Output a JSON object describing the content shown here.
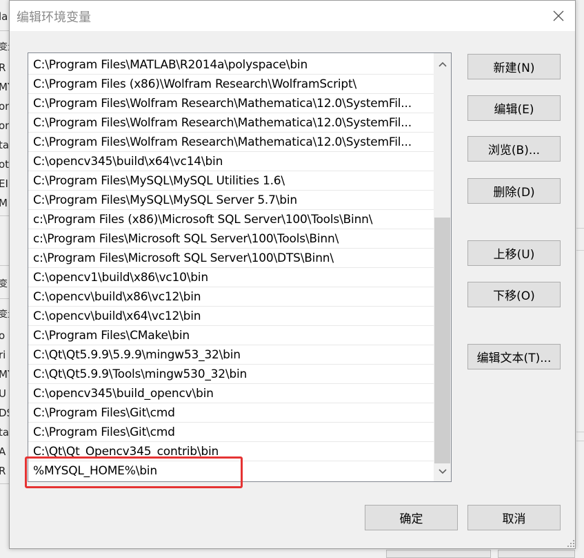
{
  "dialog": {
    "title": "编辑环境变量"
  },
  "path_list": {
    "items": [
      "C:\\Program Files\\MATLAB\\R2014a\\polyspace\\bin",
      "C:\\Program Files (x86)\\Wolfram Research\\WolframScript\\",
      "C:\\Program Files\\Wolfram Research\\Mathematica\\12.0\\SystemFil...",
      "C:\\Program Files\\Wolfram Research\\Mathematica\\12.0\\SystemFil...",
      "C:\\Program Files\\Wolfram Research\\Mathematica\\12.0\\SystemFil...",
      "C:\\opencv345\\build\\x64\\vc14\\bin",
      "C:\\Program Files\\MySQL\\MySQL Utilities 1.6\\",
      "C:\\Program Files\\MySQL\\MySQL Server 5.7\\bin",
      "c:\\Program Files (x86)\\Microsoft SQL Server\\100\\Tools\\Binn\\",
      "c:\\Program Files\\Microsoft SQL Server\\100\\Tools\\Binn\\",
      "c:\\Program Files\\Microsoft SQL Server\\100\\DTS\\Binn\\",
      "C:\\opencv1\\build\\x86\\vc10\\bin",
      "C:\\opencv\\build\\x86\\vc12\\bin",
      "C:\\opencv\\build\\x64\\vc12\\bin",
      "C:\\Program Files\\CMake\\bin",
      "C:\\Qt\\Qt5.9.9\\5.9.9\\mingw53_32\\bin",
      "C:\\Qt\\Qt5.9.9\\Tools\\mingw530_32\\bin",
      "C:\\opencv345\\build_opencv\\bin",
      "C:\\Program Files\\Git\\cmd",
      "C:\\Program Files\\Git\\cmd",
      "C:\\Qt\\Qt_Opencv345_contrib\\bin",
      "%MYSQL_HOME%\\bin"
    ]
  },
  "buttons": {
    "new": "新建(N)",
    "edit": "编辑(E)",
    "browse": "浏览(B)...",
    "delete": "删除(D)",
    "move_up": "上移(U)",
    "move_down": "下移(O)",
    "edit_text": "编辑文本(T)...",
    "ok": "确定",
    "cancel": "取消"
  },
  "background_fragments": [
    "la",
    "变量",
    "R",
    "MY",
    "on",
    "on",
    "ta",
    "ot",
    "EI",
    "M",
    "变",
    "变量",
    "o",
    "ri",
    "MY",
    "U",
    "DS",
    "ta",
    "A",
    "R"
  ],
  "colors": {
    "highlight": "#e53333",
    "dialog_bg": "#f0f0f0",
    "button_bg": "#e1e1e1"
  },
  "icons": {
    "close": "close-icon",
    "scroll_up": "chevron-up-icon",
    "scroll_down": "chevron-down-icon",
    "grip": "resize-grip-icon"
  }
}
